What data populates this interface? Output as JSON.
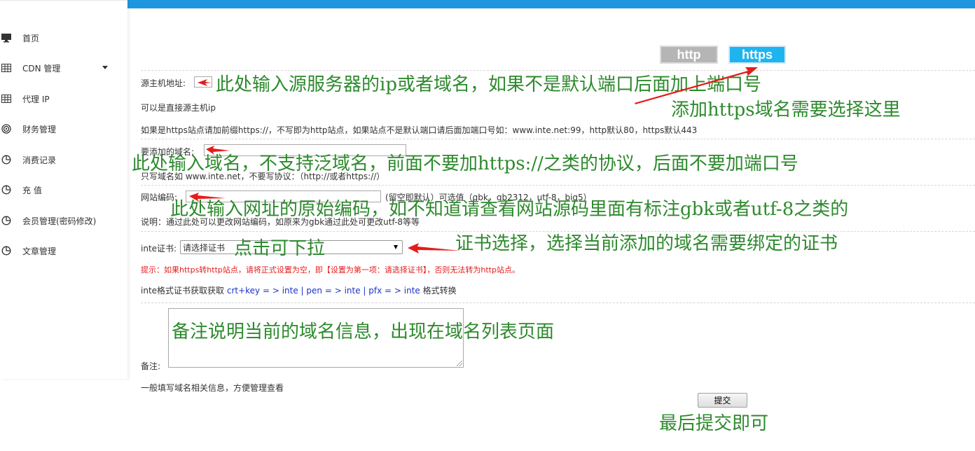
{
  "sidebar": {
    "items": [
      {
        "label": "首页",
        "icon": "monitor-icon"
      },
      {
        "label": "CDN 管理",
        "icon": "grid-icon"
      },
      {
        "label": "代理 IP",
        "icon": "grid-icon"
      },
      {
        "label": "财务管理",
        "icon": "fingerprint-icon"
      },
      {
        "label": "消费记录",
        "icon": "pie-chart-icon"
      },
      {
        "label": "充 值",
        "icon": "pie-chart-icon"
      },
      {
        "label": "会员管理(密码修改)",
        "icon": "pie-chart-icon"
      },
      {
        "label": "文章管理",
        "icon": "pie-chart-icon"
      }
    ]
  },
  "colors": {
    "topbar": "#1e97e0",
    "https_button": "#1eb4f0",
    "http_button": "#b5b5b5",
    "annotation": "#2d8a2d",
    "arrow": "#e51c1c"
  },
  "protocol": {
    "http": "http",
    "https": "https"
  },
  "form": {
    "origin_label": "源主机地址:",
    "origin_hint": "可以是直接源主机ip",
    "https_hint": "如果是https站点请加前缀https://，不写即为http站点，如果站点不是默认端口请后面加端口号如：www.inte.net:99，http默认80，https默认443",
    "domain_label": "要添加的域名:",
    "domain_hint": "只写域名如 www.inte.net，不要写协议：（http://或者https://）",
    "encoding_label": "网站编码:",
    "encoding_hint": "(留空即默认）可选值（gbk，gb2312，utf-8，big5）",
    "encoding_note": "说明：通过此处可以更改网站编码，如原来为gbk通过此处可更改utf-8等等",
    "cert_label": "inte证书:",
    "cert_selected": "请选择证书",
    "cert_warning": "提示：如果https转http站点，请将正式设置为空，即【设置为第一项：请选择证书】，否则无法转为http站点。",
    "cert_format_prefix": "inte格式证书获取获取",
    "cert_format_links": "crt+key = > inte | pen = > inte | pfx = > inte",
    "cert_format_suffix": "格式转换",
    "remark_label": "备注:",
    "remark_hint": "一般填写域名相关信息，方便管理查看",
    "submit_label": "提交"
  },
  "annotations": {
    "origin": "此处输入源服务器的ip或者域名，如果不是默认端口后面加上端口号",
    "https_choose": "添加https域名需要选择这里",
    "domain": "此处输入域名，不支持泛域名，前面不要加https://之类的协议，后面不要加端口号",
    "encoding": "此处输入网址的原始编码，如不知道请查看网站源码里面有标注gbk或者utf-8之类的",
    "dropdown": "点击可下拉",
    "cert": "证书选择，选择当前添加的域名需要绑定的证书",
    "remark": "备注说明当前的域名信息，出现在域名列表页面",
    "submit": "最后提交即可"
  }
}
